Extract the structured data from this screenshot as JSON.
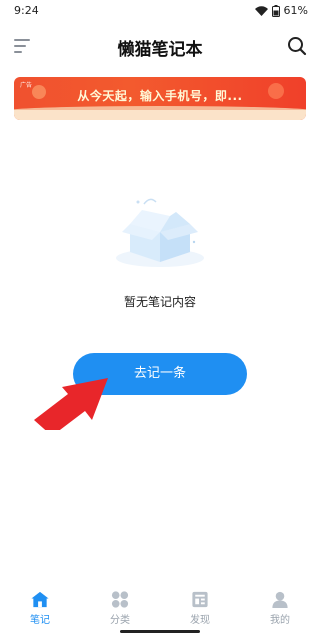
{
  "status_bar": {
    "time": "9:24",
    "battery": "61%"
  },
  "header": {
    "title": "懒猫笔记本",
    "menu_icon": "menu-icon",
    "search_icon": "search-icon"
  },
  "ad": {
    "label": "广告",
    "text": "从今天起，输入手机号，即..."
  },
  "empty_state": {
    "message": "暂无笔记内容",
    "button_label": "去记一条"
  },
  "bottom_nav": {
    "items": [
      {
        "label": "笔记",
        "icon": "home-icon",
        "active": true
      },
      {
        "label": "分类",
        "icon": "category-icon",
        "active": false
      },
      {
        "label": "发现",
        "icon": "discover-icon",
        "active": false
      },
      {
        "label": "我的",
        "icon": "profile-icon",
        "active": false
      }
    ]
  },
  "colors": {
    "accent": "#1f8ff2",
    "arrow": "#e8262a",
    "ad_background": "#f0512f",
    "inactive_nav": "#9aa3ad"
  }
}
